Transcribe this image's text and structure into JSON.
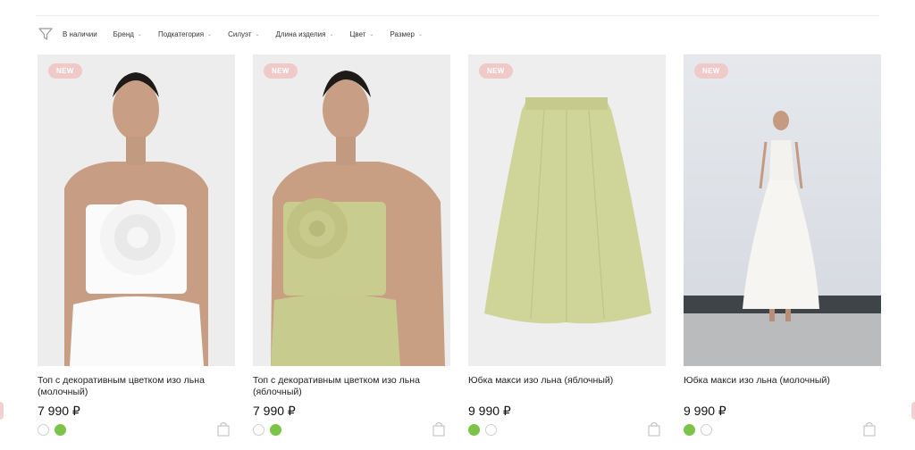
{
  "filters": {
    "items": [
      {
        "label": "В наличии",
        "dropdown": false
      },
      {
        "label": "Бренд",
        "dropdown": true
      },
      {
        "label": "Подкатегория",
        "dropdown": true
      },
      {
        "label": "Силуэт",
        "dropdown": true
      },
      {
        "label": "Длина изделия",
        "dropdown": true
      },
      {
        "label": "Цвет",
        "dropdown": true
      },
      {
        "label": "Размер",
        "dropdown": true
      }
    ]
  },
  "products": [
    {
      "badge": "NEW",
      "title": "Топ с декоративным цветком изо льна (молочный)",
      "price": "7 990 ₽",
      "swatches": [
        "#ffffff",
        "#7cc34a"
      ]
    },
    {
      "badge": "NEW",
      "title": "Топ с декоративным цветком изо льна (яблочный)",
      "price": "7 990 ₽",
      "swatches": [
        "#ffffff",
        "#7cc34a"
      ]
    },
    {
      "badge": "NEW",
      "title": "Юбка макси изо льна (яблочный)",
      "price": "9 990 ₽",
      "swatches": [
        "#7cc34a",
        "#ffffff"
      ]
    },
    {
      "badge": "NEW",
      "title": "Юбка макси изо льна (молочный)",
      "price": "9 990 ₽",
      "swatches": [
        "#7cc34a",
        "#ffffff"
      ]
    }
  ],
  "colors": {
    "badge": "#f0c9c9",
    "accent_green": "#7cc34a"
  }
}
